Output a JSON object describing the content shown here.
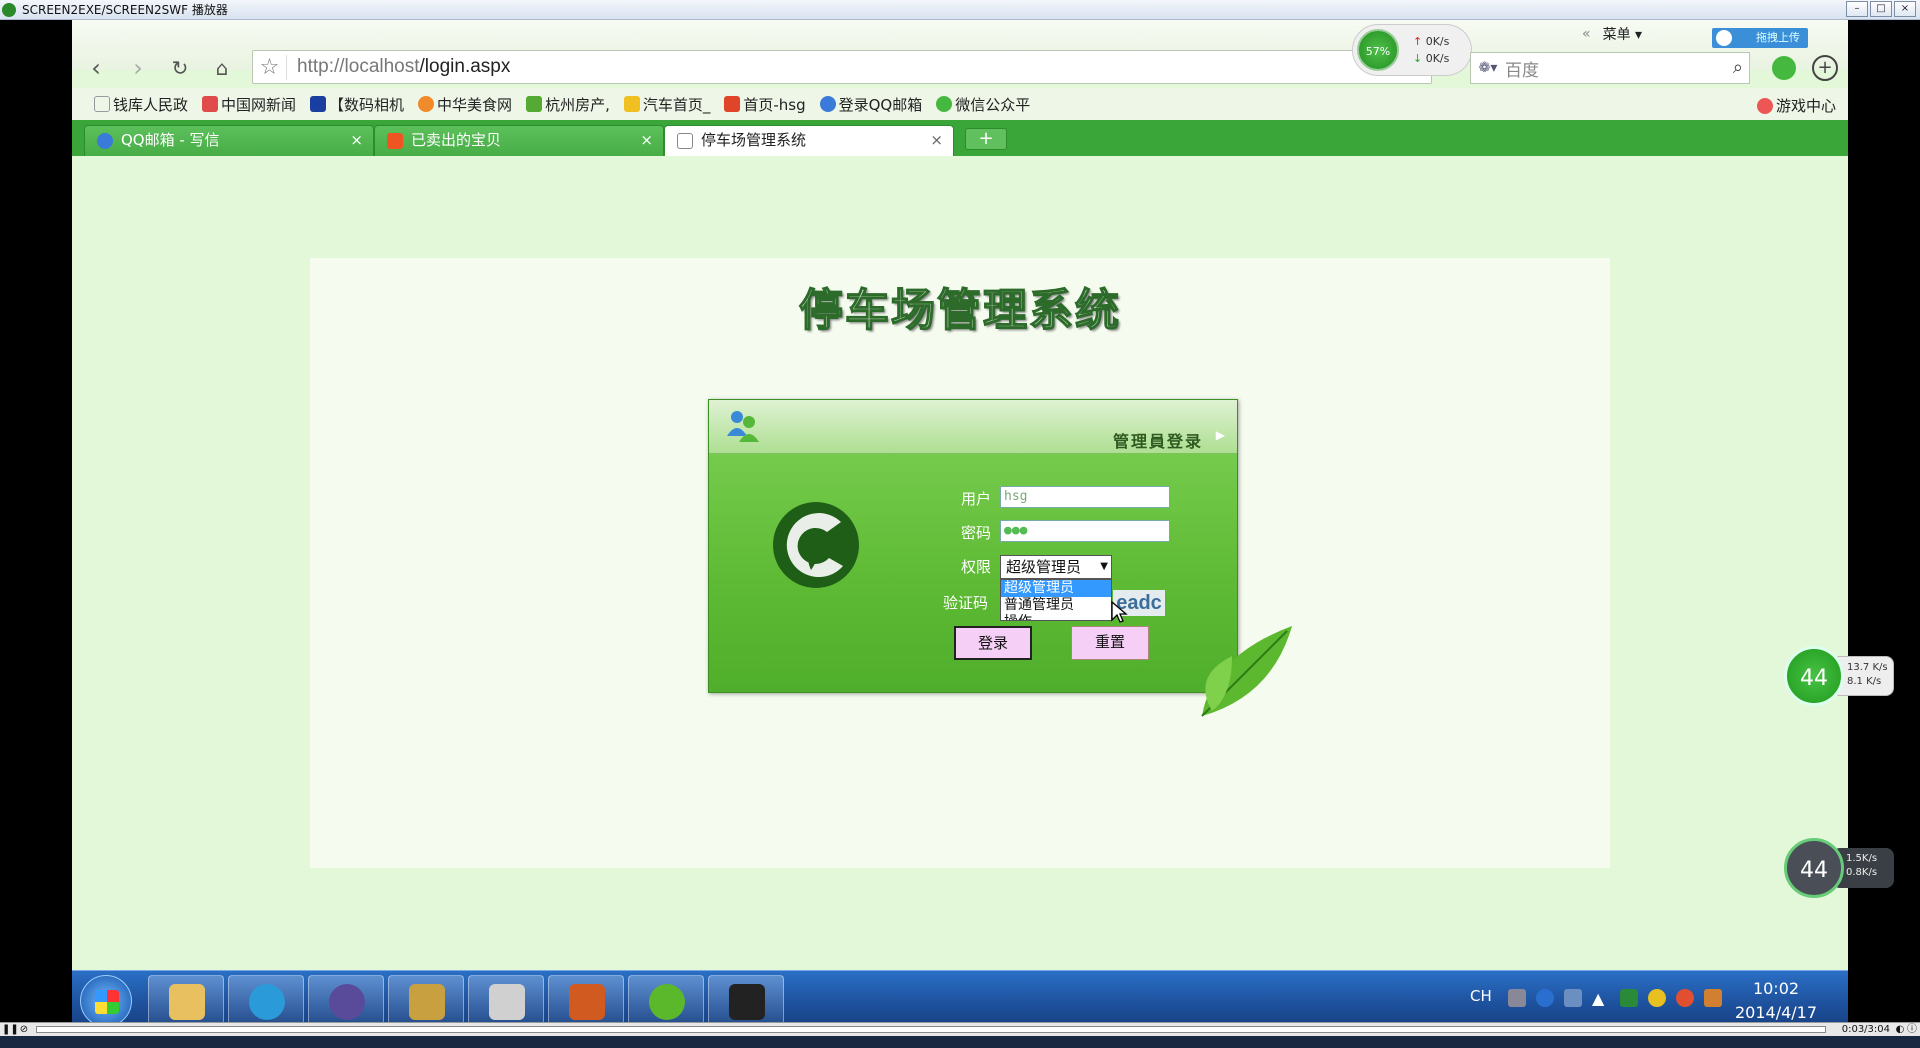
{
  "player": {
    "title": "SCREEN2EXE/SCREEN2SWF 播放器",
    "time": "0:03/3:04"
  },
  "browser": {
    "url_host": "http://localhost",
    "url_path": "/login.aspx",
    "menu_label": "菜单",
    "upload_label": "拖拽上传",
    "search_placeholder": "百度",
    "net_widget": {
      "percent": "57%",
      "up": "0K/s",
      "down": "0K/s"
    },
    "bookmarks": [
      {
        "label": "钱库人民政",
        "color": "#ffffff"
      },
      {
        "label": "中国网新闻",
        "color": "#e04a4a"
      },
      {
        "label": "【数码相机",
        "color": "#1a3fa0"
      },
      {
        "label": "中华美食网",
        "color": "#f08a2a"
      },
      {
        "label": "杭州房产,",
        "color": "#55aa33"
      },
      {
        "label": "汽车首页_",
        "color": "#f0c020"
      },
      {
        "label": "首页-hsg",
        "color": "#e0452a"
      },
      {
        "label": "登录QQ邮箱",
        "color": "#3a7ad8"
      },
      {
        "label": "微信公众平",
        "color": "#45b83f"
      }
    ],
    "bookmark_right": "游戏中心",
    "tabs": [
      {
        "label": "QQ邮箱 - 写信",
        "icon_color": "#3a7ad8"
      },
      {
        "label": "已卖出的宝贝",
        "icon_color": "#ee5522"
      },
      {
        "label": "停车场管理系统",
        "icon_color": "#ffffff"
      }
    ]
  },
  "page": {
    "system_title": "停车场管理系统",
    "login_header": "管理員登录",
    "fields": {
      "user_label": "用户",
      "user_value": "hsg",
      "password_label": "密码",
      "password_value": "●●●",
      "role_label": "权限",
      "role_selected": "超级管理员",
      "role_options": [
        "超级管理员",
        "普通管理员",
        "操作"
      ],
      "captcha_label": "验证码",
      "captcha_value": "eadc"
    },
    "buttons": {
      "login": "登录",
      "reset": "重置"
    }
  },
  "widgets": {
    "net_a": {
      "percent": "44",
      "up": "13.7 K/s",
      "down": "8.1 K/s"
    },
    "net_b": {
      "percent": "44",
      "up": "1.5K/s",
      "down": "0.8K/s"
    }
  },
  "taskbar": {
    "lang": "CH",
    "time": "10:02",
    "date": "2014/4/17",
    "apps": [
      {
        "name": "explorer",
        "color": "#e8c060"
      },
      {
        "name": "browser",
        "color": "#2a9ad8"
      },
      {
        "name": "eclipse",
        "color": "#5a4a9a"
      },
      {
        "name": "server",
        "color": "#c8a040"
      },
      {
        "name": "tools",
        "color": "#d0d0d0"
      },
      {
        "name": "visualstudio",
        "color": "#d05a20"
      },
      {
        "name": "dreamweaver",
        "color": "#5ab82a"
      },
      {
        "name": "capture",
        "color": "#222222"
      }
    ]
  }
}
